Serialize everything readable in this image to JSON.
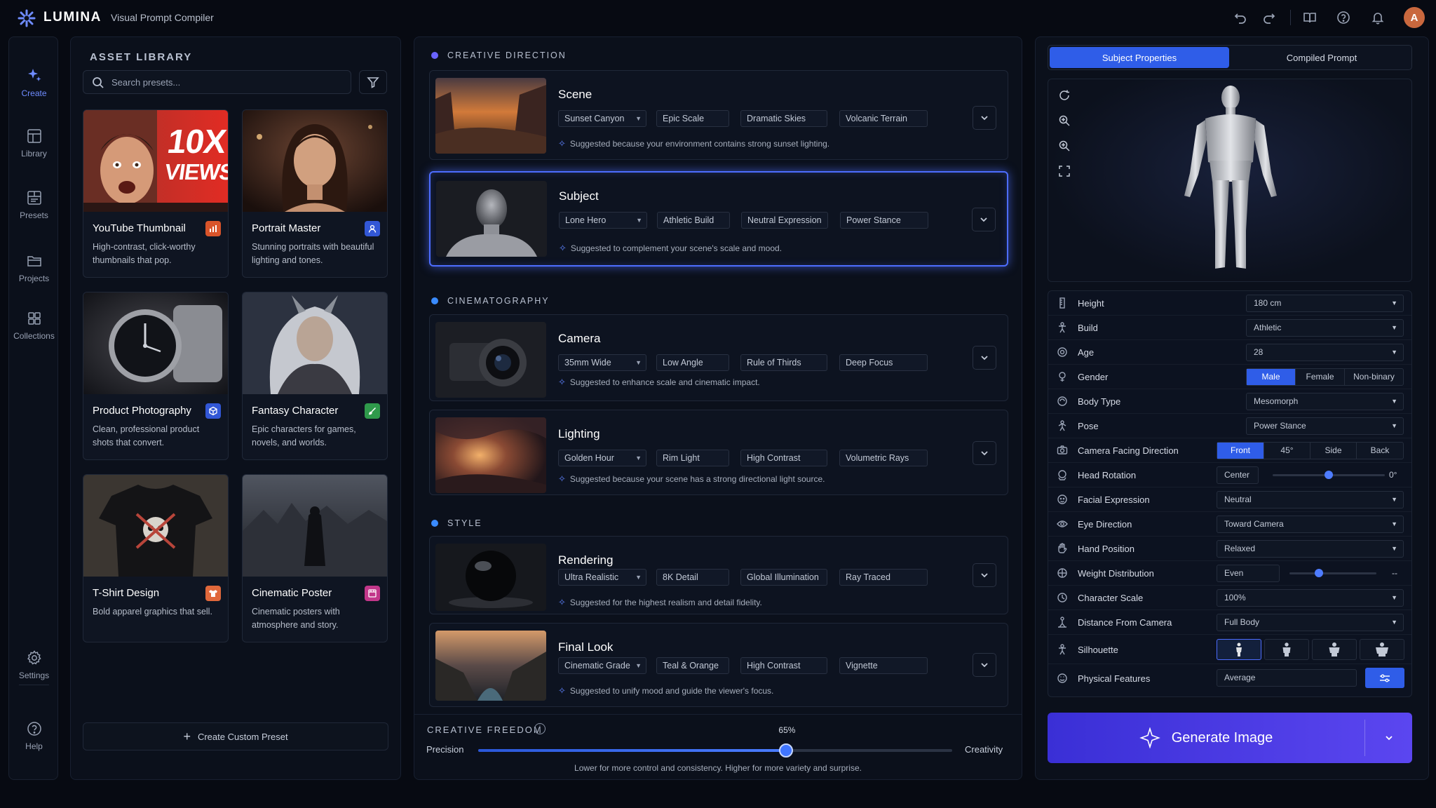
{
  "app": {
    "brand": "LUMINA",
    "subtitle": "Visual Prompt Compiler",
    "avatar_letter": "A"
  },
  "nav": [
    {
      "label": "Create",
      "icon": "sparkle-icon",
      "active": true
    },
    {
      "label": "Library",
      "icon": "library-icon"
    },
    {
      "label": "Presets",
      "icon": "presets-icon"
    },
    {
      "label": "Projects",
      "icon": "folder-icon"
    },
    {
      "label": "Collections",
      "icon": "grid-icon"
    },
    {
      "label": "Settings",
      "icon": "gear-icon"
    },
    {
      "label": "Help",
      "icon": "help-icon"
    }
  ],
  "library": {
    "title": "ASSET LIBRARY",
    "search_placeholder": "Search presets...",
    "presets": [
      {
        "title": "YouTube Thumbnail",
        "desc": "High-contrast, click-worthy thumbnails that pop.",
        "badge": "#d9542a",
        "overlay": "10X VIEWS",
        "overlay1": "10X",
        "overlay2": "VIEWS"
      },
      {
        "title": "Portrait Master",
        "desc": "Stunning portraits with beautiful lighting and tones.",
        "badge": "#3257d6"
      },
      {
        "title": "Product Photography",
        "desc": "Clean, professional product shots that convert.",
        "badge": "#3257d6"
      },
      {
        "title": "Fantasy Character",
        "desc": "Epic characters for games, novels, and worlds.",
        "badge": "#2f9a4b"
      },
      {
        "title": "T-Shirt Design",
        "desc": "Bold apparel graphics that sell.",
        "badge": "#e0683b"
      },
      {
        "title": "Cinematic Poster",
        "desc": "Cinematic posters with atmosphere and story.",
        "badge": "#c2378a"
      }
    ],
    "create_custom": "Create Custom Preset"
  },
  "sections": {
    "creative_direction": "CREATIVE DIRECTION",
    "cinematography": "CINEMATOGRAPHY",
    "style": "STYLE"
  },
  "rows": {
    "scene": {
      "title": "Scene",
      "chips": [
        "Sunset Canyon",
        "Epic Scale",
        "Dramatic Skies",
        "Volcanic Terrain"
      ],
      "suggestion": "Suggested because your environment contains strong sunset lighting."
    },
    "subject": {
      "title": "Subject",
      "chips": [
        "Lone Hero",
        "Athletic Build",
        "Neutral Expression",
        "Power Stance"
      ],
      "suggestion": "Suggested to complement your scene's scale and mood."
    },
    "camera": {
      "title": "Camera",
      "chips": [
        "35mm Wide",
        "Low Angle",
        "Rule of Thirds",
        "Deep Focus"
      ],
      "suggestion": "Suggested to enhance scale and cinematic impact."
    },
    "lighting": {
      "title": "Lighting",
      "chips": [
        "Golden Hour",
        "Rim Light",
        "High Contrast",
        "Volumetric Rays"
      ],
      "suggestion": "Suggested because your scene has a strong directional light source."
    },
    "rendering": {
      "title": "Rendering",
      "chips": [
        "Ultra Realistic",
        "8K Detail",
        "Global Illumination",
        "Ray Traced"
      ],
      "suggestion": "Suggested for the highest realism and detail fidelity."
    },
    "final_look": {
      "title": "Final Look",
      "chips": [
        "Cinematic Grade",
        "Teal & Orange",
        "High Contrast",
        "Vignette"
      ],
      "suggestion": "Suggested to unify mood and guide the viewer's focus."
    }
  },
  "freedom": {
    "title": "CREATIVE FREEDOM",
    "value": 65,
    "value_label": "65%",
    "left_label": "Precision",
    "right_label": "Creativity",
    "hint": "Lower for more control and consistency. Higher for more variety and surprise."
  },
  "right": {
    "tabs": [
      "Subject Properties",
      "Compiled Prompt"
    ],
    "props": {
      "height": {
        "label": "Height",
        "value": "180 cm"
      },
      "build": {
        "label": "Build",
        "value": "Athletic"
      },
      "age": {
        "label": "Age",
        "value": "28"
      },
      "gender": {
        "label": "Gender",
        "options": [
          "Male",
          "Female",
          "Non-binary"
        ],
        "selected": "Male"
      },
      "body_type": {
        "label": "Body Type",
        "value": "Mesomorph"
      },
      "pose": {
        "label": "Pose",
        "value": "Power Stance"
      },
      "facing": {
        "label": "Camera Facing Direction",
        "options": [
          "Front",
          "45°",
          "Side",
          "Back"
        ],
        "selected": "Front"
      },
      "head_rotation": {
        "label": "Head Rotation",
        "value_label": "Center",
        "readout": "0°",
        "level": 0.5
      },
      "facial_expression": {
        "label": "Facial Expression",
        "value": "Neutral"
      },
      "eye_direction": {
        "label": "Eye Direction",
        "value": "Toward Camera"
      },
      "hand_position": {
        "label": "Hand Position",
        "value": "Relaxed"
      },
      "weight": {
        "label": "Weight Distribution",
        "value_label": "Even",
        "readout": "--",
        "level": 0.34
      },
      "character_scale": {
        "label": "Character Scale",
        "value": "100%"
      },
      "distance": {
        "label": "Distance From Camera",
        "value": "Full Body"
      },
      "silhouette": {
        "label": "Silhouette"
      },
      "physical": {
        "label": "Physical Features",
        "value": "Average"
      }
    },
    "generate": "Generate Image"
  },
  "colors": {
    "accent": "#2f5de8",
    "selection": "#4d6dff",
    "generate": "#4a3ae6"
  }
}
